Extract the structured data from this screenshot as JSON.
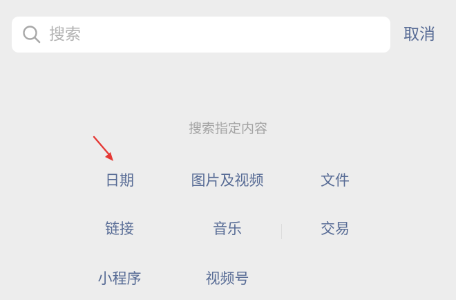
{
  "search": {
    "placeholder": "搜索",
    "value": ""
  },
  "cancel_label": "取消",
  "section_title": "搜索指定内容",
  "categories": [
    {
      "label": "日期"
    },
    {
      "label": "图片及视频"
    },
    {
      "label": "文件"
    },
    {
      "label": "链接"
    },
    {
      "label": "音乐"
    },
    {
      "label": "交易"
    },
    {
      "label": "小程序"
    },
    {
      "label": "视频号"
    }
  ],
  "colors": {
    "background": "#ededed",
    "link": "#576b95",
    "muted": "#a3a3a3",
    "annotation_arrow": "#e53935"
  },
  "icons": {
    "search": "search-icon",
    "annotation": "red-arrow-icon"
  }
}
